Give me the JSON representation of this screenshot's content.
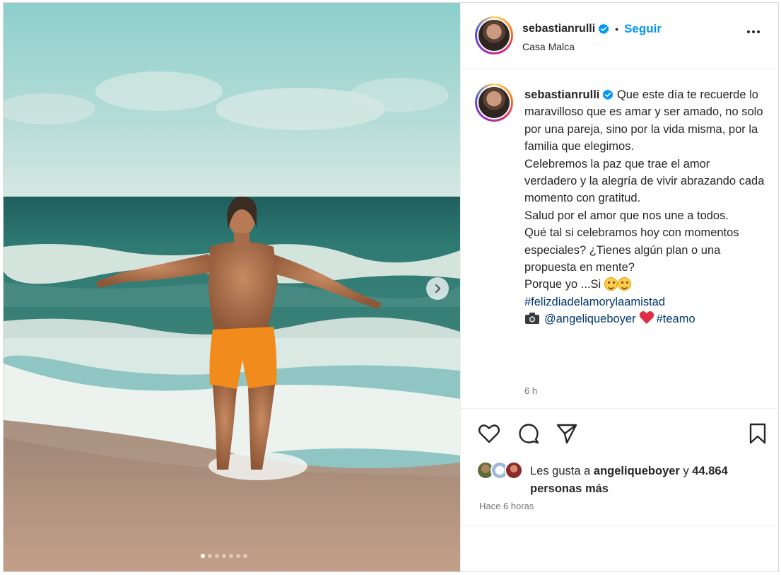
{
  "post": {
    "username": "sebastianrulli",
    "follow_label": "Seguir",
    "location": "Casa Malca",
    "bullet": "•"
  },
  "caption": {
    "username": "sebastianrulli",
    "line1": "Que este día te recuerde lo maravilloso que es amar y ser amado, no solo por una pareja, sino por la vida misma, por la familia que elegimos.",
    "line2": "Celebremos la paz que trae el amor verdadero y la alegría de vivir abrazando cada momento con gratitud.",
    "line3": "Salud por el amor que nos une a todos.",
    "line4": "Qué tal si celebramos hoy con momentos especiales? ¿Tienes algún plan o una propuesta en mente?",
    "line5": "Porque yo ...Si",
    "hashtag1": "#felizdiadelamorylaamistad",
    "mention": "@angeliqueboyer",
    "hashtag2": "#teamo",
    "time": "6 h"
  },
  "likes": {
    "prefix": "Les gusta a",
    "user": "angeliqueboyer",
    "connector": "y",
    "count": "44.864",
    "suffix": "personas más"
  },
  "posted_ago": "Hace 6 horas",
  "carousel": {
    "slides": 7,
    "active_index": 0
  },
  "colors": {
    "follow": "#0095f6",
    "link": "#00376b",
    "verified": "#0095f6",
    "heart": "#ff3040"
  },
  "icons": [
    "verified-icon",
    "more-icon",
    "like-icon",
    "comment-icon",
    "share-icon",
    "save-icon",
    "camera-icon",
    "red-heart-icon",
    "next-arrow-icon"
  ]
}
